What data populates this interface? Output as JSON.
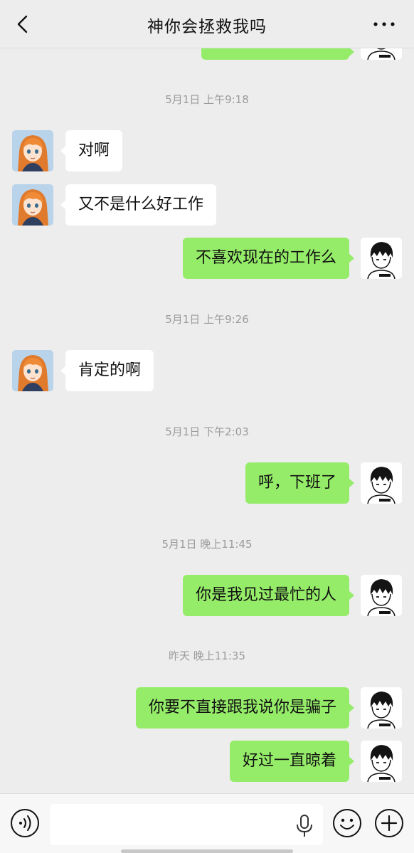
{
  "header": {
    "title": "神你会拯救我吗",
    "back_icon": "chevron-left-icon",
    "more_icon": "more-dots-icon"
  },
  "colors": {
    "background": "#ededed",
    "sent_bubble": "#95ec69",
    "received_bubble": "#ffffff",
    "timestamp_text": "#9b9b9b"
  },
  "messages": {
    "ts1": "5月1日 上午9:18",
    "m1": "对啊",
    "m2": "又不是什么好工作",
    "m3": "不喜欢现在的工作么",
    "ts2": "5月1日 上午9:26",
    "m4": "肯定的啊",
    "ts3": "5月1日 下午2:03",
    "m5": "呼，下班了",
    "ts4": "5月1日 晚上11:45",
    "m6": "你是我见过最忙的人",
    "ts5": "昨天 晚上11:35",
    "m7": "你要不直接跟我说你是骗子",
    "m8": "好过一直晾着"
  },
  "input_bar": {
    "voice_icon": "voice-icon",
    "mic_icon": "mic-icon",
    "emoji_icon": "emoji-icon",
    "plus_icon": "plus-icon",
    "text_value": ""
  }
}
